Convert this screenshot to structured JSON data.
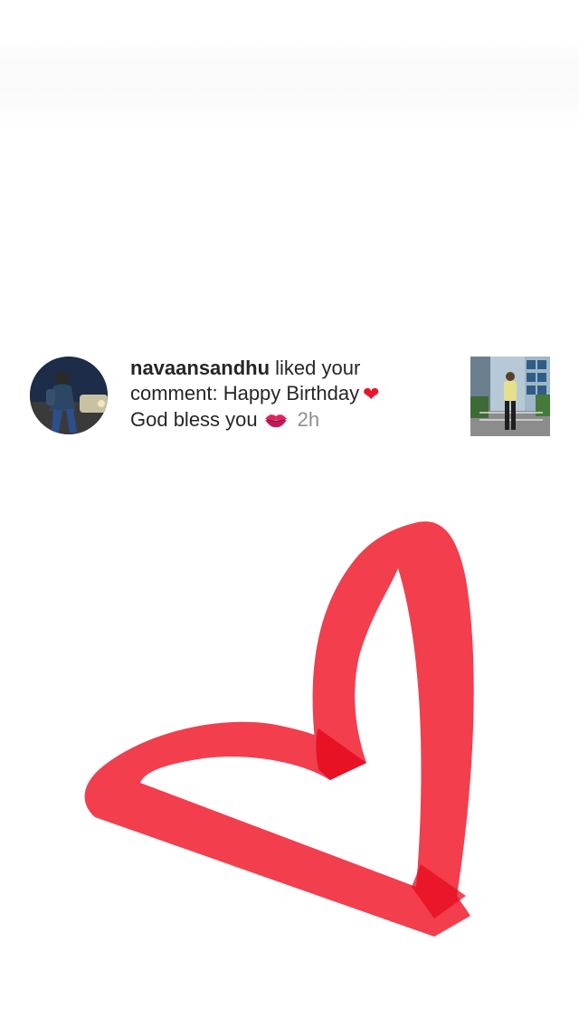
{
  "notification": {
    "username": "navaansandhu",
    "line1_rest": " liked your",
    "line2": "comment: Happy Birthday",
    "line3": "God bless you",
    "time": "2h",
    "heart_emoji": "❤",
    "kiss_emoji_icon": "kiss-mark-icon",
    "avatar_icon": "user-avatar-photo",
    "post_icon": "post-thumbnail-photo"
  },
  "drawing": {
    "shape": "heart-icon",
    "color": "#f13443"
  }
}
